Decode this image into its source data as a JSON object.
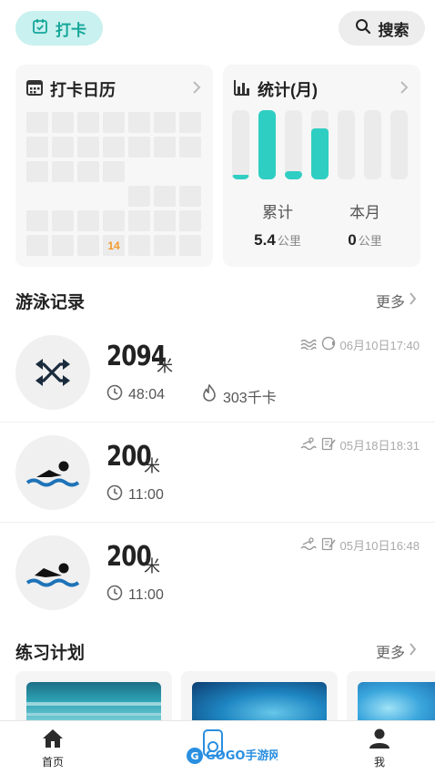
{
  "top": {
    "checkin_label": "打卡",
    "search_label": "搜索"
  },
  "calendar": {
    "title": "打卡日历",
    "highlight_day": "14"
  },
  "stats": {
    "title": "统计(月)",
    "bar_levels": [
      0.05,
      1.0,
      0.12,
      0.74,
      0,
      0,
      0
    ],
    "accent_color": "#2fcec3",
    "total_label": "累计",
    "total_value": "5.4",
    "total_unit": "公里",
    "month_label": "本月",
    "month_value": "0",
    "month_unit": "公里"
  },
  "records": {
    "title": "游泳记录",
    "more_label": "更多",
    "items": [
      {
        "distance": "2094",
        "unit": "米",
        "duration": "48:04",
        "calories": "303千卡",
        "date": "06月10日17:40",
        "icon": "shuffle-icon"
      },
      {
        "distance": "200",
        "unit": "米",
        "duration": "11:00",
        "date": "05月18日18:31",
        "icon": "swimmer-icon"
      },
      {
        "distance": "200",
        "unit": "米",
        "duration": "11:00",
        "date": "05月10日16:48",
        "icon": "swimmer-icon"
      }
    ]
  },
  "plans": {
    "title": "练习计划",
    "more_label": "更多"
  },
  "tabbar": {
    "home_label": "首页",
    "me_label": "我",
    "watermark_text": "GOGO手游网"
  }
}
